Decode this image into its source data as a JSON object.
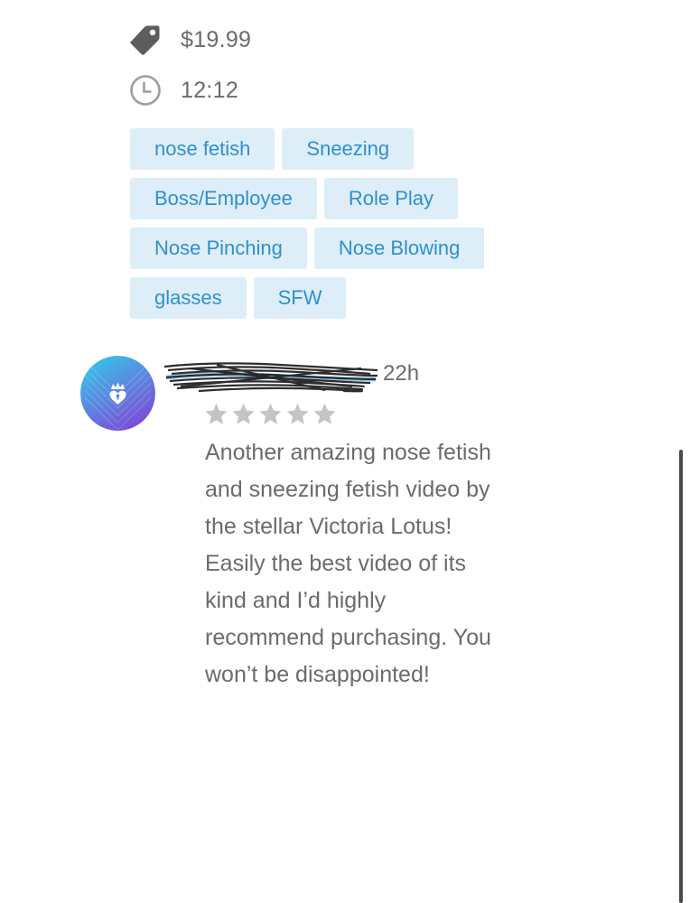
{
  "details": {
    "price": "$19.99",
    "duration": "12:12"
  },
  "tags": [
    [
      "nose fetish",
      "Sneezing"
    ],
    [
      "Boss/Employee",
      "Role Play"
    ],
    [
      "Nose Pinching",
      "Nose Blowing"
    ],
    [
      "glasses",
      "SFW"
    ]
  ],
  "review": {
    "time_ago": "22h",
    "rating": 0,
    "rating_max": 5,
    "text": "Another amazing nose fetish and sneezing fetish video by the stellar Victoria Lotus! Easily the best video of its kind and I’d highly recommend purchasing. You won’t be disappointed!"
  },
  "colors": {
    "tag_bg": "#ddeef9",
    "tag_text": "#2f8fcf",
    "star_empty": "#c4c4c4",
    "avatar_gradient_start": "#2fd0ea",
    "avatar_gradient_end": "#7a4fd8"
  },
  "icons": {
    "price": "price-tag-icon",
    "duration": "clock-icon",
    "avatar": "crown-heart-icon",
    "rating": "star-icon"
  }
}
